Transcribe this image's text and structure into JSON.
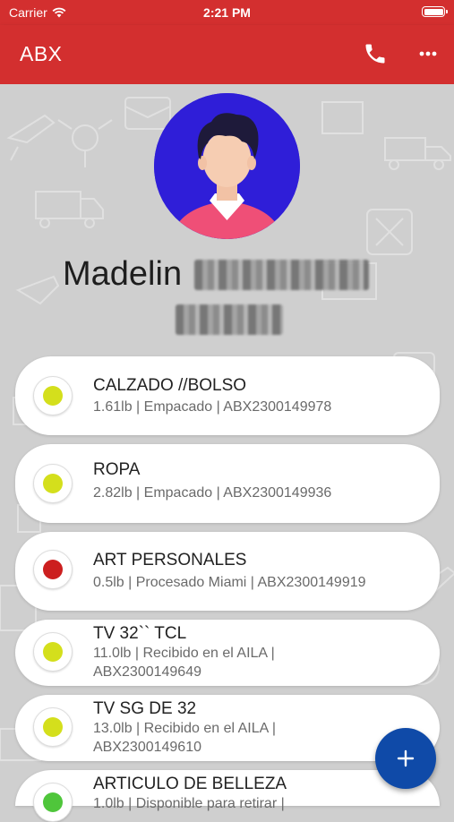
{
  "status_bar": {
    "carrier": "Carrier",
    "time": "2:21 PM"
  },
  "app_bar": {
    "title": "ABX",
    "phone_icon": "phone-icon",
    "more_icon": "more-horizontal-icon",
    "color": "#d32f2f"
  },
  "profile": {
    "first_name": "Madelin"
  },
  "packages": [
    {
      "title": "CALZADO //BOLSO",
      "sub1": "1.61lb | Empacado | ABX2300149978",
      "sub2": "",
      "status_color": "#d4df1c"
    },
    {
      "title": "ROPA",
      "sub1": "2.82lb | Empacado | ABX2300149936",
      "sub2": "",
      "status_color": "#d4df1c"
    },
    {
      "title": "ART PERSONALES",
      "sub1": "0.5lb | Procesado Miami | ABX2300149919",
      "sub2": "",
      "status_color": "#cc1f1f"
    },
    {
      "title": "TV 32`` TCL",
      "sub1": "11.0lb | Recibido en el AILA |",
      "sub2": "ABX2300149649",
      "status_color": "#d4df1c"
    },
    {
      "title": "TV SG DE 32",
      "sub1": "13.0lb | Recibido en el AILA |",
      "sub2": "ABX2300149610",
      "status_color": "#d4df1c"
    },
    {
      "title": "ARTICULO DE BELLEZA",
      "sub1": "1.0lb | Disponible para retirar |",
      "sub2": "",
      "status_color": "#4fc63b"
    }
  ],
  "fab": {
    "icon": "plus-icon",
    "color": "#0f4aa8"
  }
}
